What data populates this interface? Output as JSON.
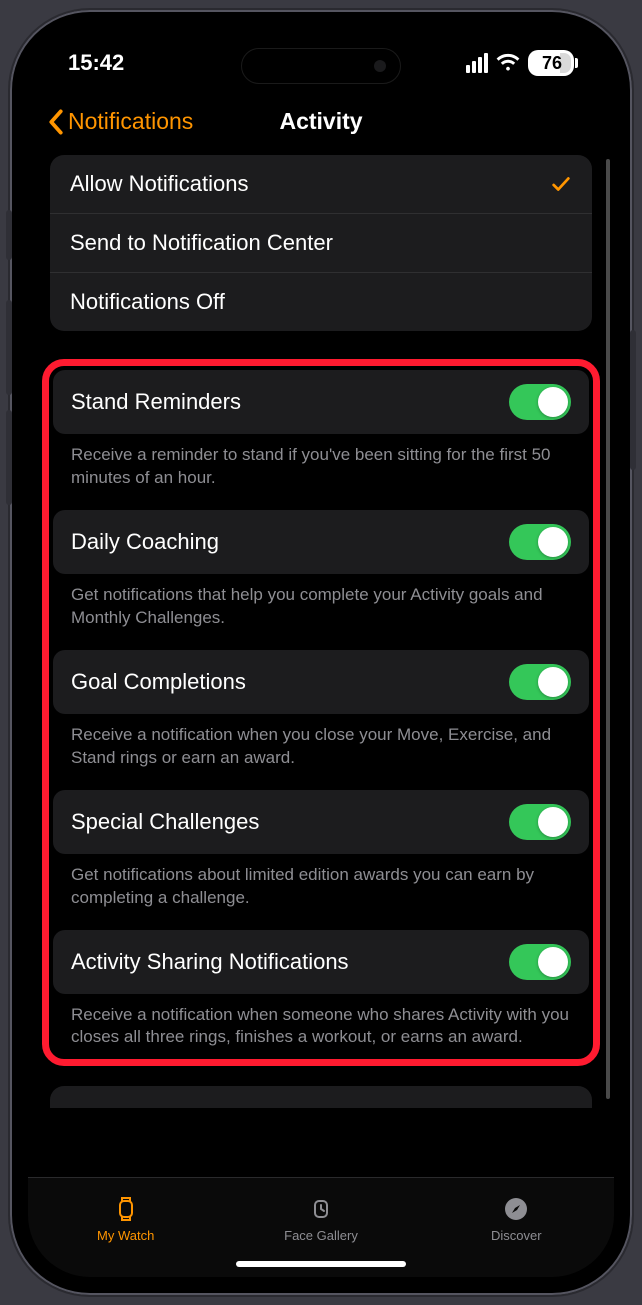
{
  "status": {
    "time": "15:42",
    "battery": "76"
  },
  "nav": {
    "back_label": "Notifications",
    "title": "Activity"
  },
  "notification_mode": {
    "options": [
      {
        "label": "Allow Notifications",
        "selected": true
      },
      {
        "label": "Send to Notification Center",
        "selected": false
      },
      {
        "label": "Notifications Off",
        "selected": false
      }
    ]
  },
  "settings": [
    {
      "title": "Stand Reminders",
      "enabled": true,
      "desc": "Receive a reminder to stand if you've been sitting for the first 50 minutes of an hour."
    },
    {
      "title": "Daily Coaching",
      "enabled": true,
      "desc": "Get notifications that help you complete your Activity goals and Monthly Challenges."
    },
    {
      "title": "Goal Completions",
      "enabled": true,
      "desc": "Receive a notification when you close your Move, Exercise, and Stand rings or earn an award."
    },
    {
      "title": "Special Challenges",
      "enabled": true,
      "desc": "Get notifications about limited edition awards you can earn by completing a challenge."
    },
    {
      "title": "Activity Sharing Notifications",
      "enabled": true,
      "desc": "Receive a notification when someone who shares Activity with you closes all three rings, finishes a workout, or earns an award."
    }
  ],
  "tabs": [
    {
      "label": "My Watch",
      "icon": "watch-icon",
      "active": true
    },
    {
      "label": "Face Gallery",
      "icon": "watch-face-icon",
      "active": false
    },
    {
      "label": "Discover",
      "icon": "compass-icon",
      "active": false
    }
  ]
}
